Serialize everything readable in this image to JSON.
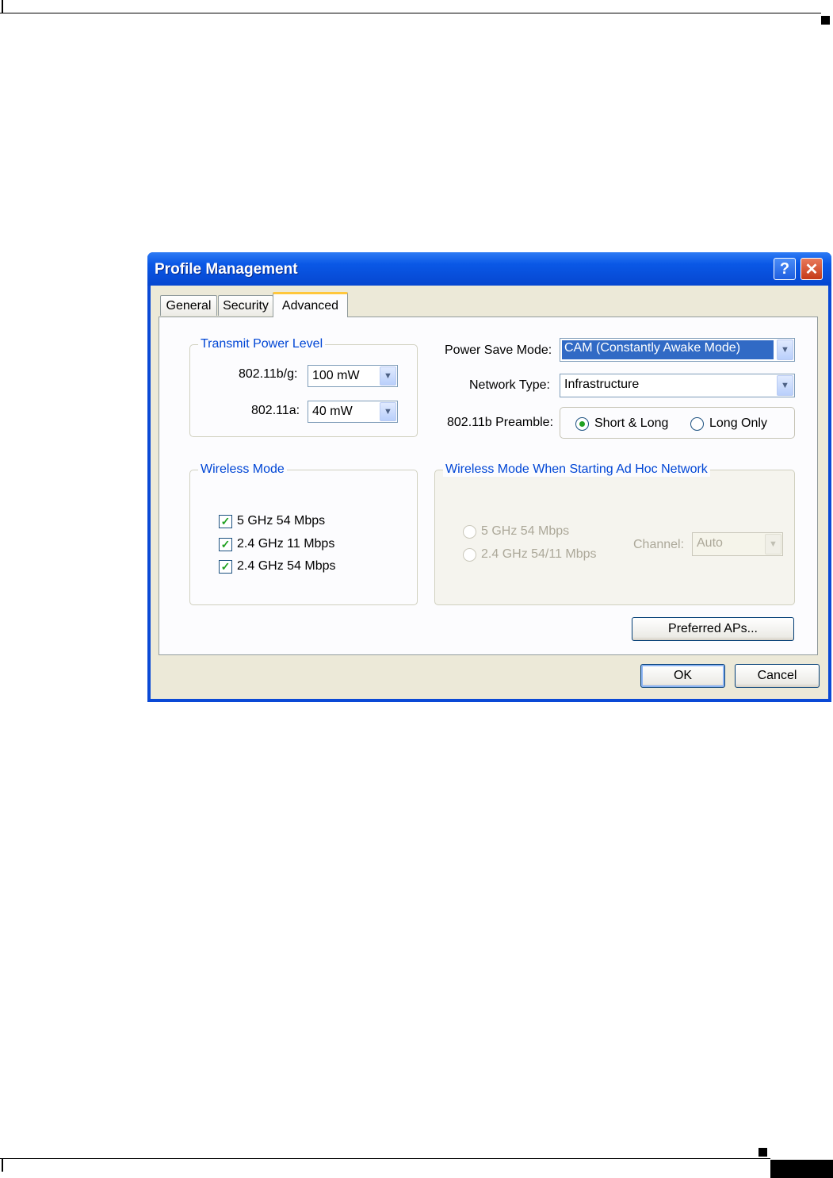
{
  "window": {
    "title": "Profile Management",
    "help_glyph": "?",
    "close_glyph": "✕",
    "help_icon": "help-icon",
    "close_icon": "close-icon"
  },
  "tabs": [
    {
      "label": "General",
      "active": false
    },
    {
      "label": "Security",
      "active": false
    },
    {
      "label": "Advanced",
      "active": true
    }
  ],
  "transmit_power": {
    "legend": "Transmit Power Level",
    "bg_label": "802.11b/g:",
    "bg_value": "100 mW",
    "a_label": "802.11a:",
    "a_value": "40 mW"
  },
  "power_save": {
    "label": "Power Save Mode:",
    "value": "CAM (Constantly Awake Mode)"
  },
  "network_type": {
    "label": "Network Type:",
    "value": "Infrastructure"
  },
  "preamble": {
    "label": "802.11b Preamble:",
    "options": [
      {
        "label": "Short & Long",
        "selected": true
      },
      {
        "label": "Long Only",
        "selected": false
      }
    ]
  },
  "wireless_mode": {
    "legend": "Wireless Mode",
    "options": [
      {
        "label": "5 GHz 54 Mbps",
        "checked": true
      },
      {
        "label": "2.4 GHz 11 Mbps",
        "checked": true
      },
      {
        "label": "2.4 GHz 54 Mbps",
        "checked": true
      }
    ]
  },
  "adhoc": {
    "legend": "Wireless Mode When Starting Ad Hoc Network",
    "options": [
      {
        "label": "5 GHz 54 Mbps",
        "selected": false
      },
      {
        "label": "2.4 GHz 54/11 Mbps",
        "selected": false
      }
    ],
    "channel_label": "Channel:",
    "channel_value": "Auto"
  },
  "buttons": {
    "preferred_aps": "Preferred APs...",
    "ok": "OK",
    "cancel": "Cancel"
  },
  "symbols": {
    "check": "✓",
    "dropdown": "▼"
  },
  "colors": {
    "titlebar": "#0a58e6",
    "client": "#ece9d8",
    "legend_text": "#0046d5",
    "selection": "#316ac5"
  }
}
